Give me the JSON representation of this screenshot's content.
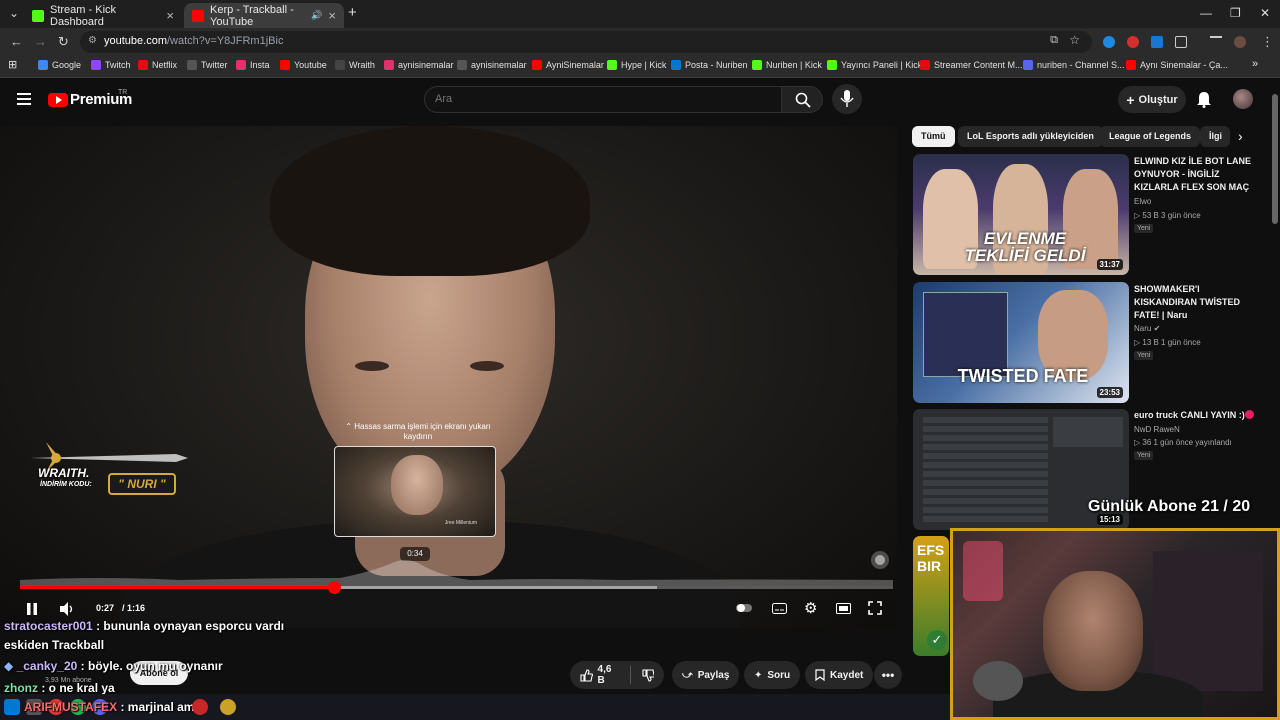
{
  "browser": {
    "tabs": [
      {
        "label": "Stream - Kick Dashboard",
        "favicon_color": "#53fc18",
        "active": false
      },
      {
        "label": "Kerp - Trackball - YouTube",
        "favicon_color": "#ff0000",
        "active": true
      }
    ],
    "new_tab": "+",
    "url_host": "youtube.com",
    "url_path": "/watch?v=Y8JFRm1jBic",
    "bookmarks": [
      {
        "label": "Google",
        "color": "#4285f4"
      },
      {
        "label": "Twitch",
        "color": "#9146ff"
      },
      {
        "label": "Netflix",
        "color": "#e50914"
      },
      {
        "label": "Twitter",
        "color": "#1d1d1d"
      },
      {
        "label": "Insta",
        "color": "#e1306c"
      },
      {
        "label": "Youtube",
        "color": "#ff0000"
      },
      {
        "label": "Wraith",
        "color": "#444444"
      },
      {
        "label": "aynisinemalar",
        "color": "#e1306c"
      },
      {
        "label": "aynisinemalar",
        "color": "#1d1d1d"
      },
      {
        "label": "AyniSinemalar",
        "color": "#ff0000"
      },
      {
        "label": "Hype | Kick",
        "color": "#53fc18"
      },
      {
        "label": "Posta - Nuriben",
        "color": "#0078d4"
      },
      {
        "label": "Nuriben | Kick",
        "color": "#53fc18"
      },
      {
        "label": "Yayıncı Paneli | Kick",
        "color": "#53fc18"
      },
      {
        "label": "Streamer Content M...",
        "color": "#e50914"
      },
      {
        "label": "nuriben - Channel S...",
        "color": "#5865f2"
      },
      {
        "label": "Aynı Sinemalar - Ça...",
        "color": "#ff0000"
      }
    ]
  },
  "header": {
    "brand": "Premium",
    "brand_sup": "TR",
    "search_placeholder": "Ara",
    "create_label": "Oluştur"
  },
  "player": {
    "scrub_hint": "Hassas sarma işlemi için ekranı yukarı kaydırın",
    "preview_time": "0:34",
    "preview_tag": "Jree Millenium",
    "current_time": "0:27",
    "total_time": "/ 1:16",
    "progress_played": 0.36,
    "progress_buffered": 0.73
  },
  "overlay": {
    "sponsor_name": "WRAITH.",
    "sponsor_code_label": "İNDİRİM KODU:",
    "sponsor_code": "\" NURI \"",
    "sub_goal": "Günlük Abone 21 / 20"
  },
  "chips": [
    {
      "label": "Tümü",
      "active": true
    },
    {
      "label": "LoL Esports adlı yükleyiciden",
      "active": false
    },
    {
      "label": "League of Legends",
      "active": false
    },
    {
      "label": "İlgi",
      "active": false
    }
  ],
  "recommendations": [
    {
      "title": "ELWIND KIZ İLE BOT LANE OYNUYOR - İNGİLİZ KIZLARLA FLEX SON MAÇ",
      "channel": "Elwo",
      "meta": "▷ 53 B   3 gün önce",
      "badge": "Yeni",
      "duration": "31:37",
      "thumb_text": "EVLENME TEKLİFİ GELDİ"
    },
    {
      "title": "SHOWMAKER'I KISKANDIRAN TWİSTED FATE! | Naru",
      "channel": "Naru ✔",
      "meta": "▷ 13 B   1 gün önce",
      "badge": "Yeni",
      "duration": "23:53",
      "thumb_text": "TWISTED FATE"
    },
    {
      "title": "euro truck CANLI YAYIN :)",
      "channel": "NwD RaweN",
      "meta": "▷ 36   1 gün önce yayınlandı",
      "badge": "Yeni",
      "duration": "15:13",
      "thumb_text": ""
    }
  ],
  "actions": {
    "likes": "4,6 B",
    "share": "Paylaş",
    "ask": "Soru",
    "save": "Kaydet",
    "subscribe": "Abone ol",
    "subscribers": "3,93 Mn abone"
  },
  "chat": [
    {
      "user": "stratocaster001",
      "text": ": bununla oynayan esporcu vardı"
    },
    {
      "user": "",
      "text": "eskiden Trackball"
    },
    {
      "user": "_canky_20",
      "text": ": böyle. oyun mu oynanır"
    },
    {
      "user": "zhonz",
      "text": ": o ne kral ya"
    },
    {
      "user": "ARIFMUSTAFEX",
      "text": ": marjinal amk"
    }
  ]
}
